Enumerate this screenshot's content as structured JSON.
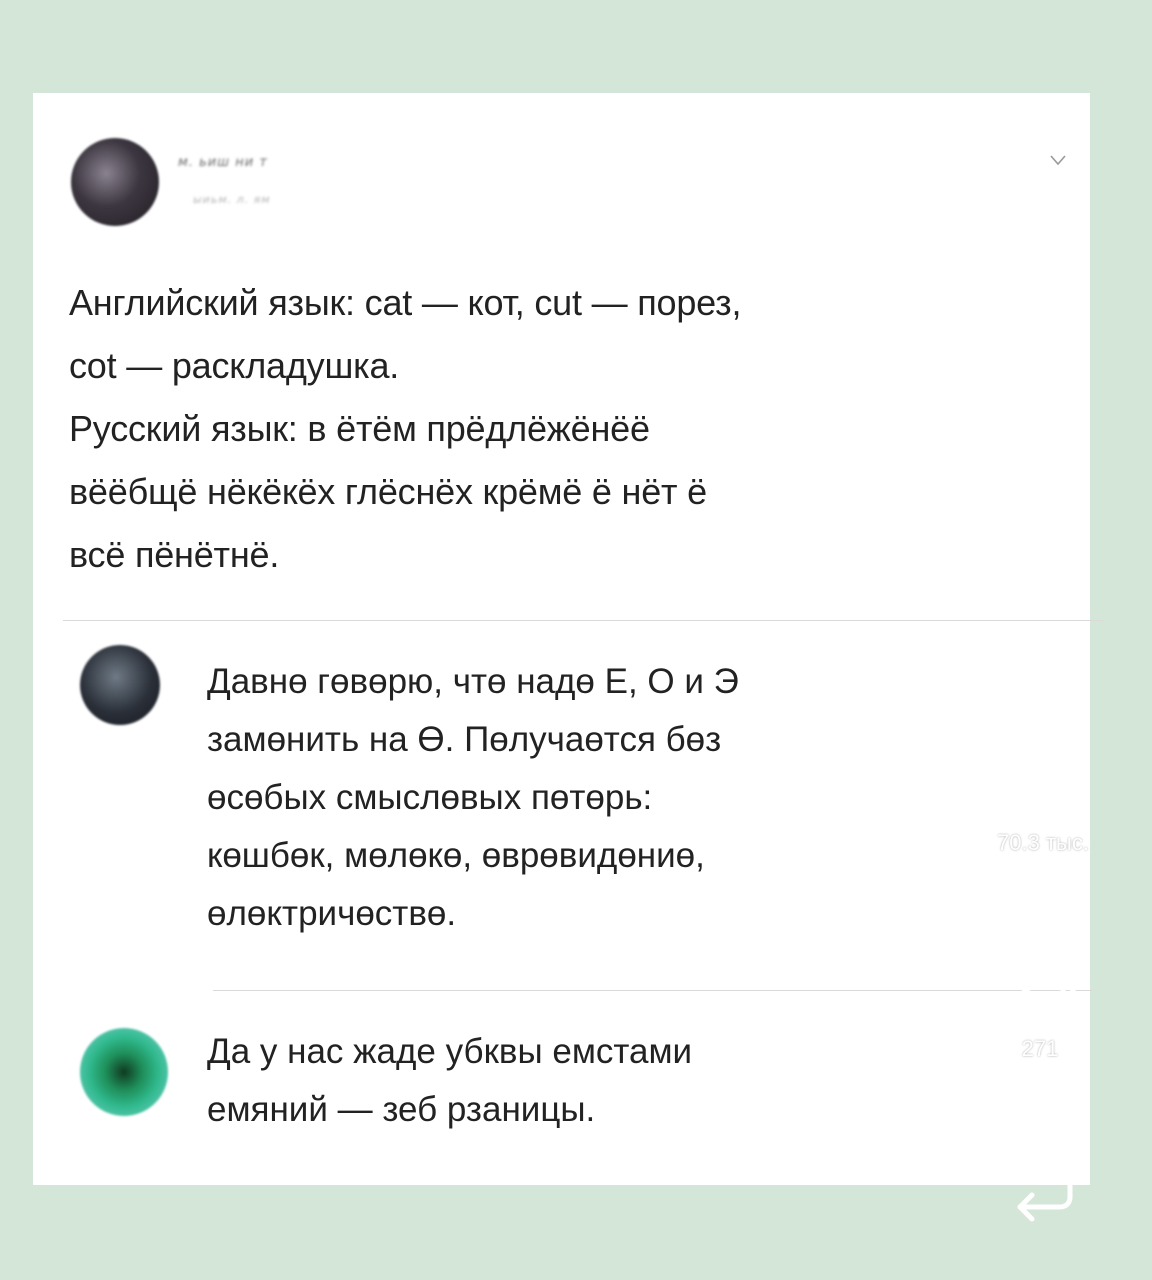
{
  "post": {
    "author_name": "м. ьиш ни т",
    "author_handle": "ыиьм. л. ям",
    "text": "Английский язык: cat — кот, cut — порез,\ncot — раскладушка.\nРусский язык: в ётём прёдлёжёнёё\nвёёбщё нёкёкёх глёснёх крёмё ё нёт ё\nвсё пёнётнё."
  },
  "replies": [
    {
      "text": "Давнө гөвөрю, чтө надө Е, О и Э\nзамөнить на Ө. Пөлучаөтся бөз\nөсөбых смыслөвых пөтөрь:\nкөшбөк, мөлөкө, өврөвидөниө,\nөлөктричөствө."
    },
    {
      "text": "Да у нас жаде убквы емстами\nемяний — зеб рзаницы."
    }
  ],
  "actions": {
    "likes": "70.3 тыс.",
    "comments": "271"
  },
  "colors": {
    "background": "#d3e6d8",
    "card": "#ffffff",
    "text": "#222222",
    "overlay_icon": "#ffffff"
  },
  "icons": {
    "menu": "chevron-down-icon",
    "like": "heart-icon",
    "comment": "comment-bubble-icon",
    "repost": "repost-arrows-icon"
  }
}
